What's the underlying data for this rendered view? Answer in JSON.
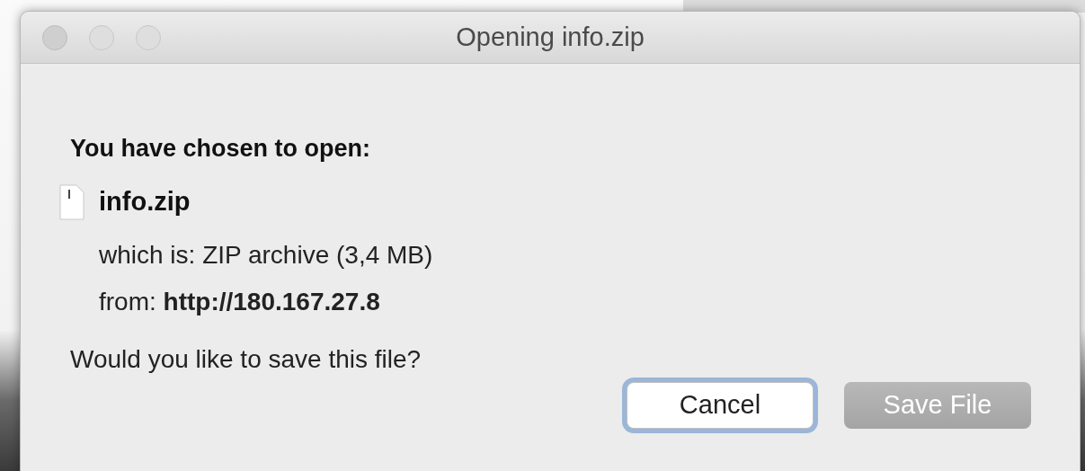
{
  "window": {
    "title": "Opening info.zip"
  },
  "heading": "You have chosen to open:",
  "file": {
    "name": "info.zip"
  },
  "details": [
    "which is: ZIP archive (3,4 MB)",
    "from: **http://180.167.27.8**"
  ],
  "question": "Would you like to save this file?",
  "buttons": [
    {
      "label": "Cancel",
      "focused": true,
      "disabled": false
    },
    {
      "label": "Save File",
      "focused": false,
      "disabled": true
    }
  ]
}
